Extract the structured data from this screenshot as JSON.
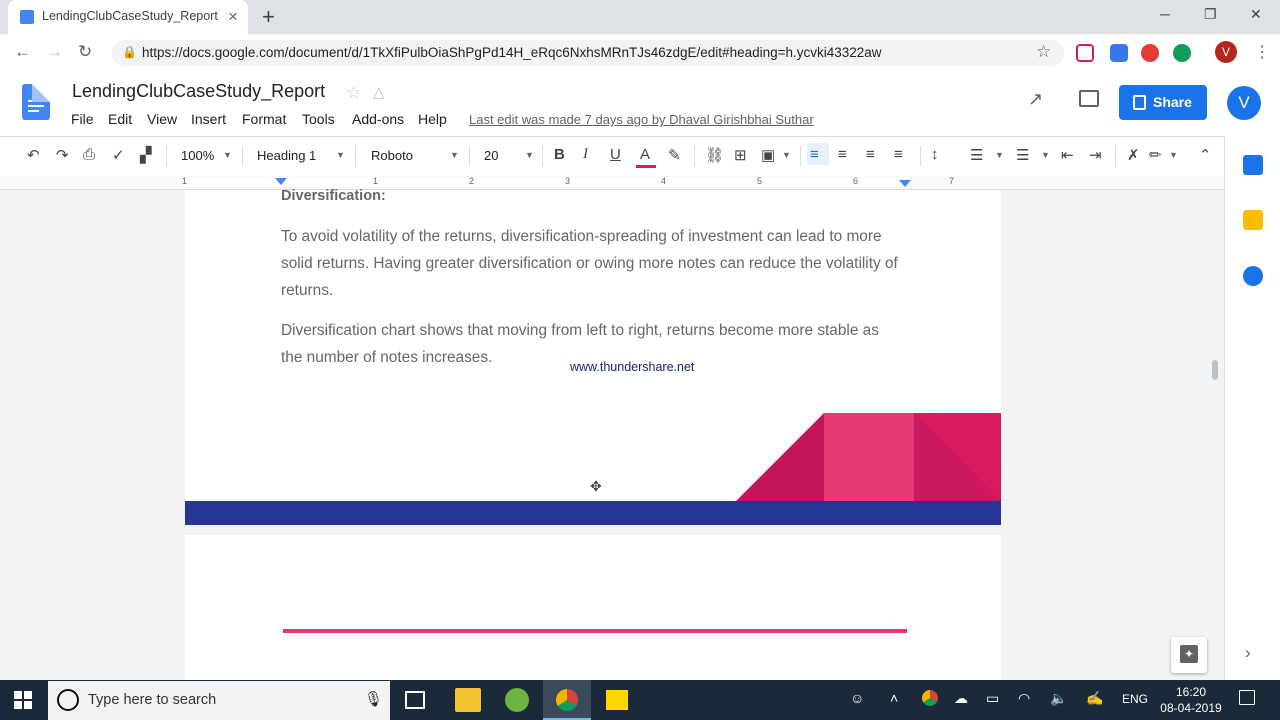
{
  "browser": {
    "tab_title": "LendingClubCaseStudy_Report - Google Docs",
    "new_tab_symbol": "+",
    "url": "https://docs.google.com/document/d/1TkXfiPulbOiaShPgPd14H_eRqc6NxhsMRnTJs46zdgE/edit#heading=h.ycvki43322aw",
    "profile_initial": "V",
    "window_controls": {
      "minimize": "─",
      "restore": "❐",
      "close": "✕"
    }
  },
  "docs": {
    "title": "LendingClubCaseStudy_Report",
    "menu": [
      "File",
      "Edit",
      "View",
      "Insert",
      "Format",
      "Tools",
      "Add-ons",
      "Help"
    ],
    "last_edit": "Last edit was made 7 days ago by Dhaval Girishbhai Suthar",
    "share_label": "Share",
    "user_initial": "V"
  },
  "toolbar": {
    "zoom": "100%",
    "style": "Heading 1",
    "font": "Roboto",
    "size": "20",
    "bold": "B",
    "italic": "I",
    "underline": "U",
    "font_color": "A"
  },
  "ruler": {
    "numbers": [
      "1",
      "1",
      "2",
      "3",
      "4",
      "5",
      "6",
      "7"
    ]
  },
  "document": {
    "heading": "Diversification:",
    "paragraph1": "To avoid volatility of the returns, diversification-spreading of investment can lead to more solid returns. Having greater diversification or owing more notes can reduce the volatility of returns.",
    "paragraph2": "Diversification chart shows that moving from left to right, returns become more stable as the number of notes increases.",
    "watermark": "www.thundershare.net"
  },
  "colors": {
    "brand_blue": "#1a73e8",
    "pink": "#e2386e",
    "navy": "#263593"
  },
  "taskbar": {
    "search_placeholder": "Type here to search",
    "language": "ENG",
    "time": "16:20",
    "date": "08-04-2019"
  }
}
